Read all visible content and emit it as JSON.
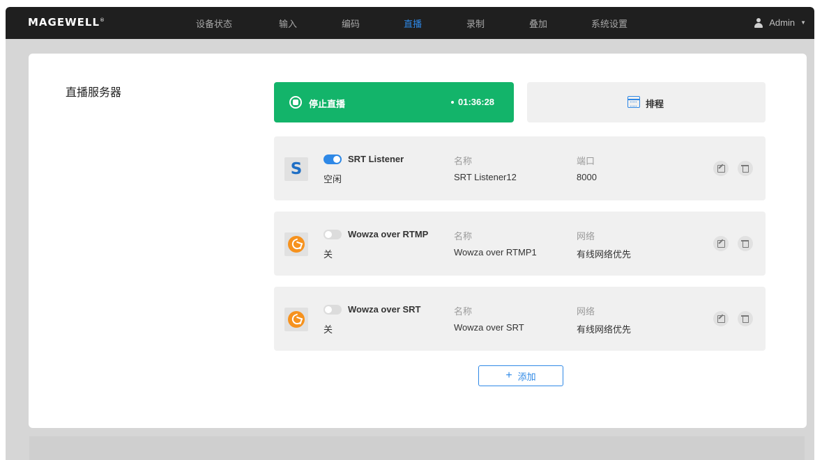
{
  "header": {
    "logo": "MAGEWELL",
    "logo_mark": "®",
    "nav": [
      "设备状态",
      "输入",
      "编码",
      "直播",
      "录制",
      "叠加",
      "系统设置"
    ],
    "active_nav": "直播",
    "user": "Admin",
    "accent_color": "#2e88e6"
  },
  "main": {
    "section_title": "直播服务器",
    "stop_button": {
      "label": "停止直播",
      "timer": "01:36:28",
      "color": "#13b46a"
    },
    "schedule_button": {
      "label": "排程"
    },
    "servers": [
      {
        "logo": "S",
        "logo_icon": "srt-logo-icon",
        "enabled": true,
        "type": "SRT Listener",
        "state": "空闲",
        "name_label": "名称",
        "name": "SRT Listener12",
        "extra_label": "端口",
        "extra_value": "8000"
      },
      {
        "logo_icon": "wowza-logo-icon",
        "enabled": false,
        "type": "Wowza over RTMP",
        "state": "关",
        "name_label": "名称",
        "name": "Wowza over RTMP1",
        "extra_label": "网络",
        "extra_value": "有线网络优先"
      },
      {
        "logo_icon": "wowza-logo-icon",
        "enabled": false,
        "type": "Wowza over SRT",
        "state": "关",
        "name_label": "名称",
        "name": "Wowza over SRT",
        "extra_label": "网络",
        "extra_value": "有线网络优先"
      }
    ],
    "add_button": {
      "icon": "+",
      "label": "添加"
    }
  }
}
